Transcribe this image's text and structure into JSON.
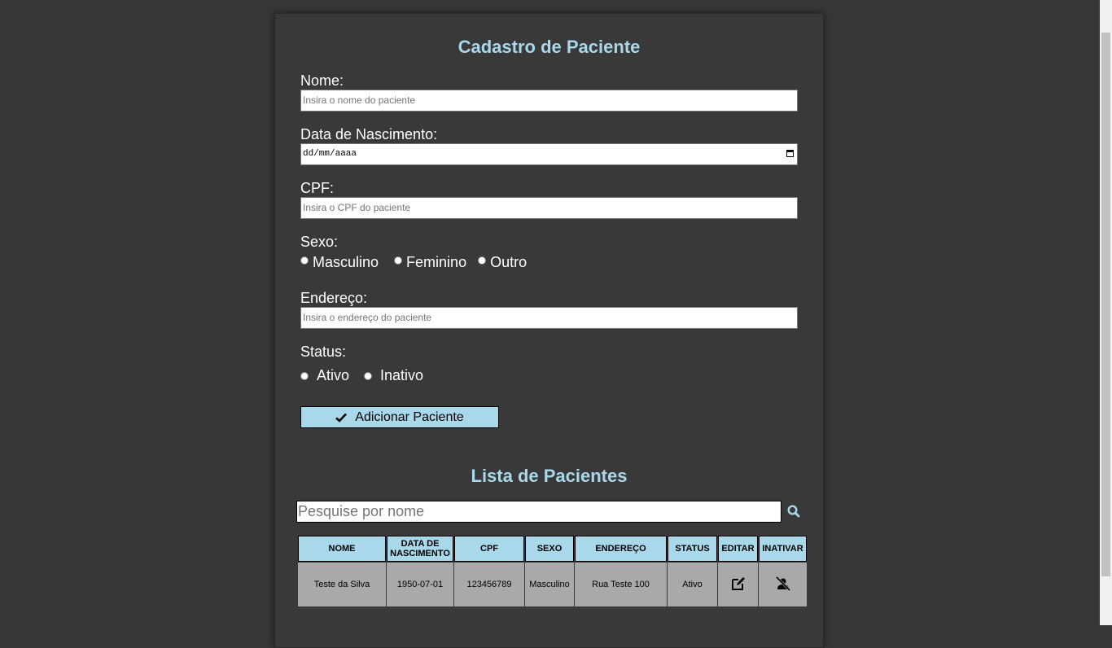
{
  "form": {
    "title": "Cadastro de Paciente",
    "nome_label": "Nome:",
    "nome_placeholder": "Insira o nome do paciente",
    "nascimento_label": "Data de Nascimento:",
    "nascimento_value": "dd/mm/aaaa",
    "cpf_label": "CPF:",
    "cpf_placeholder": "Insira o CPF do paciente",
    "sexo_label": "Sexo:",
    "sexo_options": [
      "Masculino",
      "Feminino",
      "Outro"
    ],
    "endereco_label": "Endereço:",
    "endereco_placeholder": "Insira o endereço do paciente",
    "status_label": "Status:",
    "status_options": [
      "Ativo",
      "Inativo"
    ],
    "submit_label": "Adicionar Paciente"
  },
  "list": {
    "title": "Lista de Pacientes",
    "search_placeholder": "Pesquise por nome",
    "columns": [
      "NOME",
      "DATA DE NASCIMENTO",
      "CPF",
      "SEXO",
      "ENDEREÇO",
      "STATUS",
      "EDITAR",
      "INATIVAR"
    ],
    "rows": [
      {
        "nome": "Teste da Silva",
        "nascimento": "1950-07-01",
        "cpf": "123456789",
        "sexo": "Masculino",
        "endereco": "Rua Teste 100",
        "status": "Ativo"
      }
    ]
  },
  "icons": {
    "submit": "check-icon",
    "search": "search-icon",
    "edit": "edit-icon",
    "inactivate": "user-slash-icon",
    "date": "calendar-icon"
  },
  "colors": {
    "background": "#373737",
    "accent": "#a8d8ea",
    "row": "#a9a9a9"
  }
}
